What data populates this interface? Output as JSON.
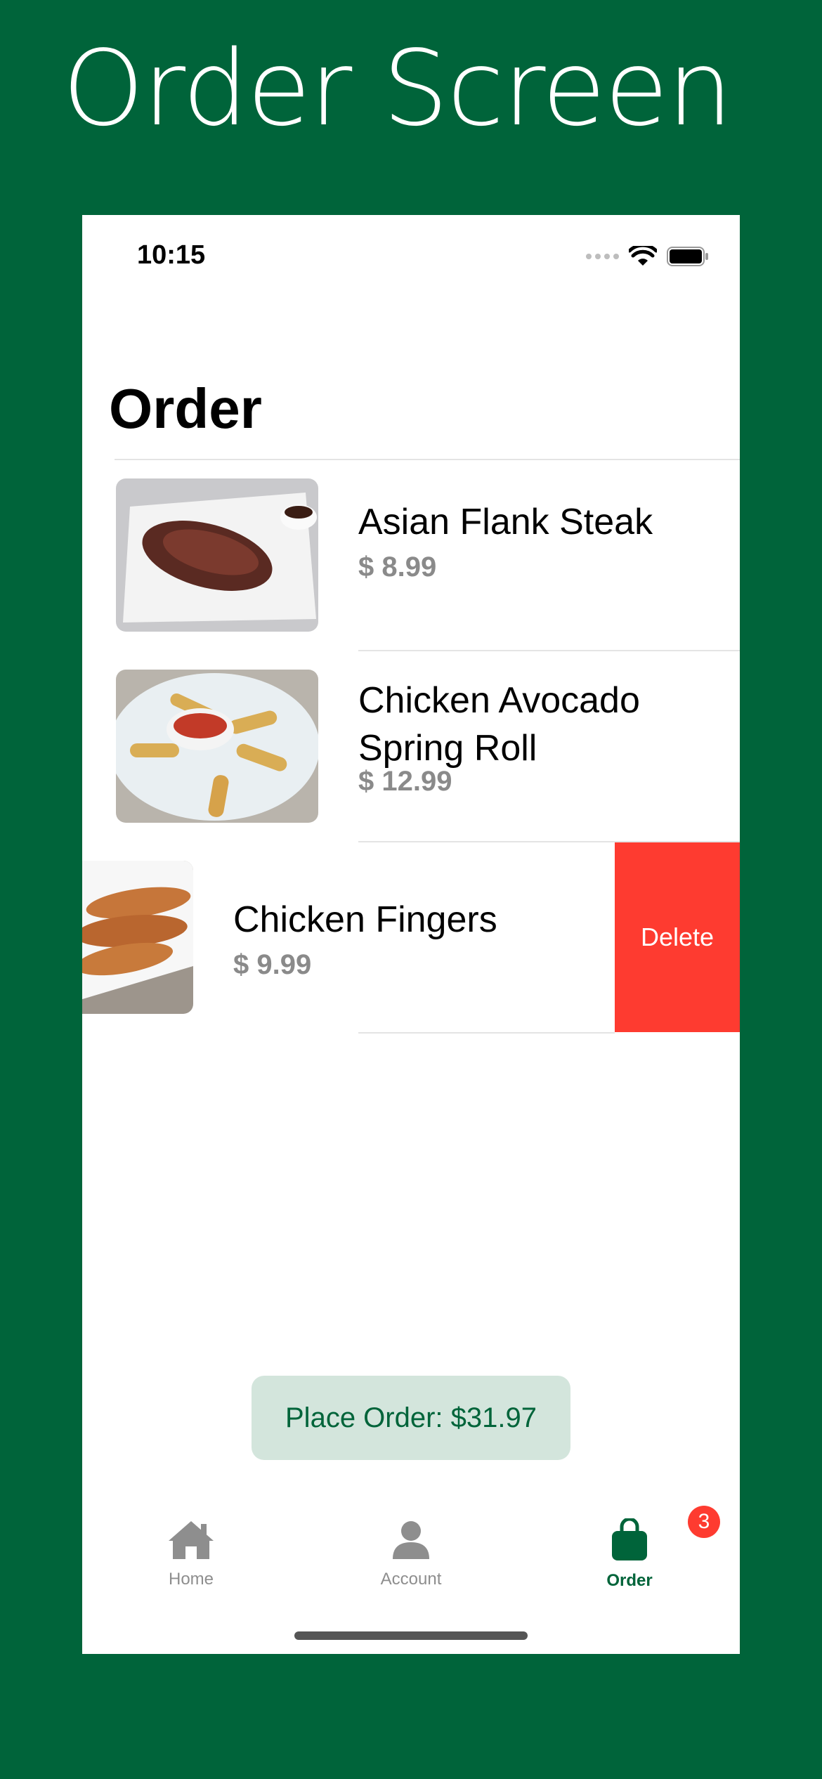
{
  "promo": {
    "title": "Order Screen"
  },
  "status_bar": {
    "time": "10:15"
  },
  "page": {
    "title": "Order"
  },
  "order_items": [
    {
      "name": "Asian Flank Steak",
      "price": "$ 8.99"
    },
    {
      "name": "Chicken Avocado Spring Roll",
      "name_line1": "Chicken Avocado",
      "name_line2": "Spring Roll",
      "price": "$ 12.99"
    },
    {
      "name": "Chicken Fingers",
      "price": "$ 9.99",
      "swipe_action": "Delete"
    }
  ],
  "place_order": {
    "label": "Place Order: $31.97"
  },
  "tab_bar": {
    "items": [
      {
        "label": "Home",
        "icon": "house-icon",
        "active": false
      },
      {
        "label": "Account",
        "icon": "person-icon",
        "active": false
      },
      {
        "label": "Order",
        "icon": "bag-icon",
        "active": true,
        "badge": "3"
      }
    ]
  },
  "colors": {
    "brand_green": "#00643a",
    "delete_red": "#fe3b30",
    "button_bg": "#d3e5dc",
    "price_gray": "#8a8a8a"
  }
}
